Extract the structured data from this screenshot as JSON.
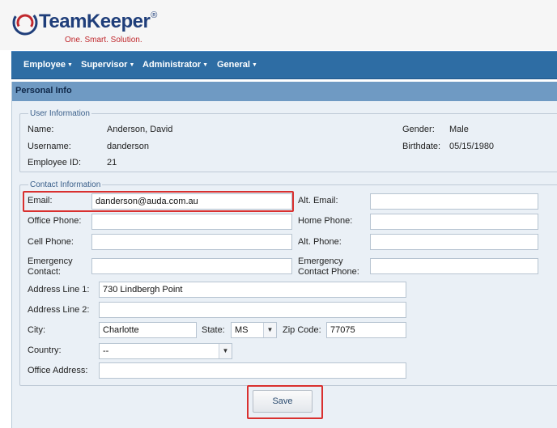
{
  "brand": {
    "name": "TeamKeeper",
    "registered": "®",
    "tagline": "One. Smart. Solution.",
    "colors": {
      "primary": "#1f3e7a",
      "accent": "#c0282d"
    }
  },
  "nav": {
    "items": [
      {
        "label": "Employee",
        "icon": "caret-down-icon"
      },
      {
        "label": "Supervisor",
        "icon": "caret-down-icon"
      },
      {
        "label": "Administrator",
        "icon": "caret-down-icon"
      },
      {
        "label": "General",
        "icon": "caret-down-icon"
      }
    ]
  },
  "panel": {
    "title": "Personal Info"
  },
  "user_info": {
    "legend": "User Information",
    "name_label": "Name:",
    "name_value": "Anderson, David",
    "username_label": "Username:",
    "username_value": "danderson",
    "employee_id_label": "Employee ID:",
    "employee_id_value": "21",
    "gender_label": "Gender:",
    "gender_value": "Male",
    "birthdate_label": "Birthdate:",
    "birthdate_value": "05/15/1980"
  },
  "contact_info": {
    "legend": "Contact Information",
    "email_label": "Email:",
    "email_value": "danderson@auda.com.au",
    "alt_email_label": "Alt. Email:",
    "alt_email_value": "",
    "office_phone_label": "Office Phone:",
    "office_phone_value": "",
    "home_phone_label": "Home Phone:",
    "home_phone_value": "",
    "cell_phone_label": "Cell Phone:",
    "cell_phone_value": "",
    "alt_phone_label": "Alt. Phone:",
    "alt_phone_value": "",
    "emergency_contact_label_1": "Emergency",
    "emergency_contact_label_2": "Contact:",
    "emergency_contact_value": "",
    "emergency_phone_label_1": "Emergency",
    "emergency_phone_label_2": "Contact Phone:",
    "emergency_phone_value": "",
    "address1_label": "Address Line 1:",
    "address1_value": "730 Lindbergh Point",
    "address2_label": "Address Line 2:",
    "address2_value": "",
    "city_label": "City:",
    "city_value": "Charlotte",
    "state_label": "State:",
    "state_value": "MS",
    "zip_label": "Zip Code:",
    "zip_value": "77075",
    "country_label": "Country:",
    "country_value": "--",
    "office_address_label": "Office Address:",
    "office_address_value": ""
  },
  "actions": {
    "save_label": "Save"
  },
  "highlight_color": "#d9302f"
}
